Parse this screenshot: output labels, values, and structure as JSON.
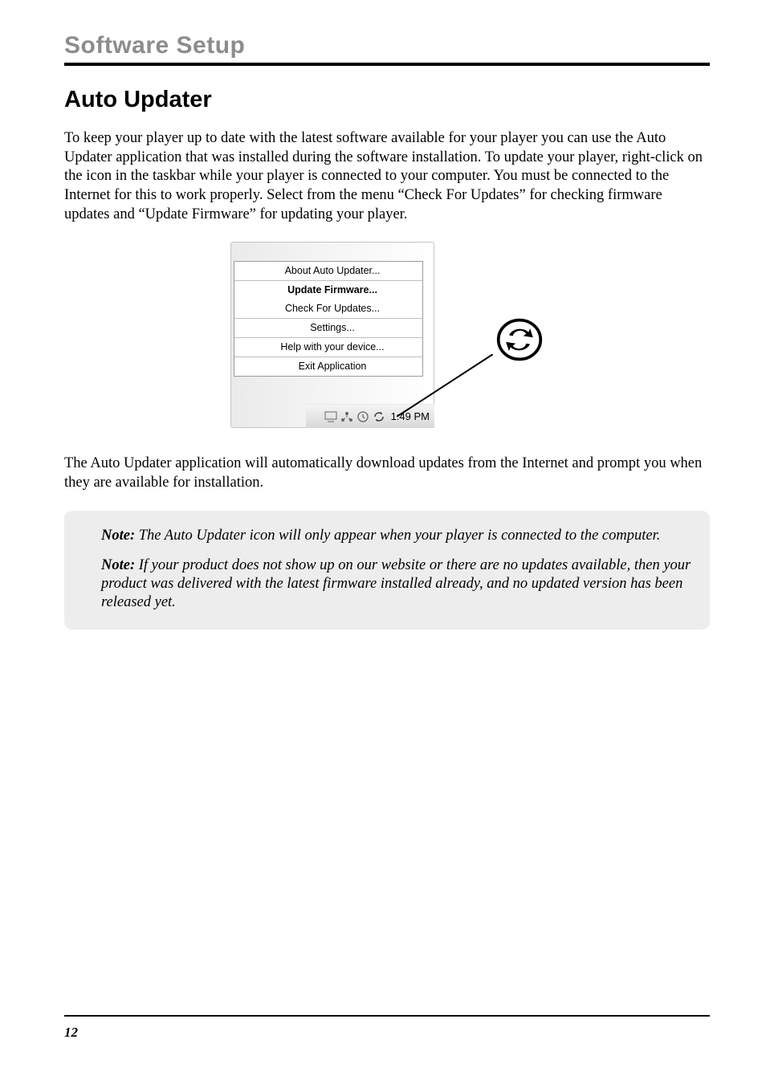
{
  "header": {
    "section": "Software Setup"
  },
  "title": "Auto Updater",
  "paragraph1": "To keep your player up to date with the latest software available for your player you can use the Auto Updater application that was installed during the software installation. To update your player, right-click on the icon in the taskbar while your player is connected to your computer. You must be connected to the Internet for this to work properly. Select from the menu “Check For Updates” for checking firmware updates and “Update Firmware” for updating your player.",
  "menu": {
    "about": "About Auto Updater...",
    "update_firmware": "Update Firmware...",
    "check_updates": "Check For Updates...",
    "settings": "Settings...",
    "help": "Help with your device...",
    "exit": "Exit Application"
  },
  "taskbar": {
    "clock": "1:49 PM"
  },
  "paragraph2": "The Auto Updater application will automatically download updates from the Internet and prompt you when they are available for installation.",
  "notes": {
    "label1": "Note:",
    "body1": "The Auto Updater icon will only appear when your player is connected to the computer.",
    "label2": "Note:",
    "body2": "If your product does not show up on our website or there are no updates available, then your product was delivered with the latest firmware installed already, and no updated version has been released yet."
  },
  "footer": {
    "page_num": "12"
  }
}
